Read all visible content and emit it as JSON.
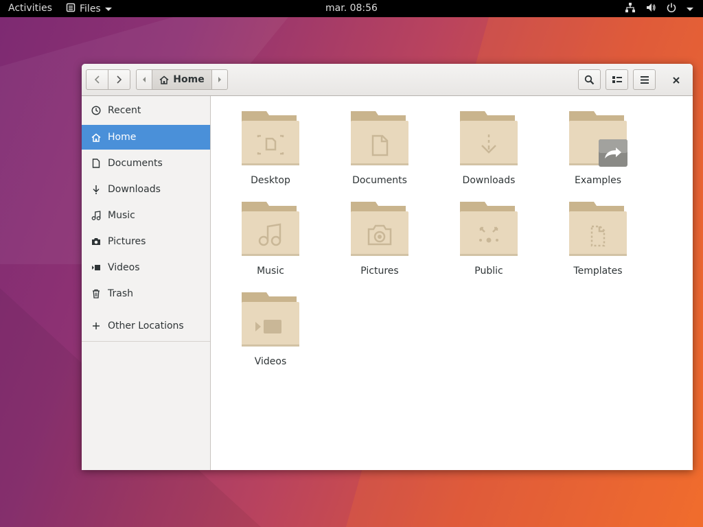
{
  "topbar": {
    "activities": "Activities",
    "app_menu": "Files",
    "clock": "mar. 08:56"
  },
  "header": {
    "path": "Home"
  },
  "sidebar": {
    "items": [
      {
        "label": "Recent",
        "icon": "clock-icon"
      },
      {
        "label": "Home",
        "icon": "home-icon",
        "active": true
      },
      {
        "label": "Documents",
        "icon": "document-icon"
      },
      {
        "label": "Downloads",
        "icon": "download-icon"
      },
      {
        "label": "Music",
        "icon": "music-icon"
      },
      {
        "label": "Pictures",
        "icon": "camera-icon"
      },
      {
        "label": "Videos",
        "icon": "video-icon"
      },
      {
        "label": "Trash",
        "icon": "trash-icon"
      }
    ],
    "other_locations": "Other Locations"
  },
  "folders": [
    {
      "label": "Desktop",
      "emblem": "desktop"
    },
    {
      "label": "Documents",
      "emblem": "document"
    },
    {
      "label": "Downloads",
      "emblem": "download"
    },
    {
      "label": "Examples",
      "emblem": "symlink"
    },
    {
      "label": "Music",
      "emblem": "music"
    },
    {
      "label": "Pictures",
      "emblem": "camera"
    },
    {
      "label": "Public",
      "emblem": "share"
    },
    {
      "label": "Templates",
      "emblem": "template"
    },
    {
      "label": "Videos",
      "emblem": "video"
    }
  ],
  "colors": {
    "accent": "#4a90d9",
    "folder_tab": "#c9b48d",
    "folder_body": "#e8d8bc",
    "emblem": "#c9b797"
  }
}
